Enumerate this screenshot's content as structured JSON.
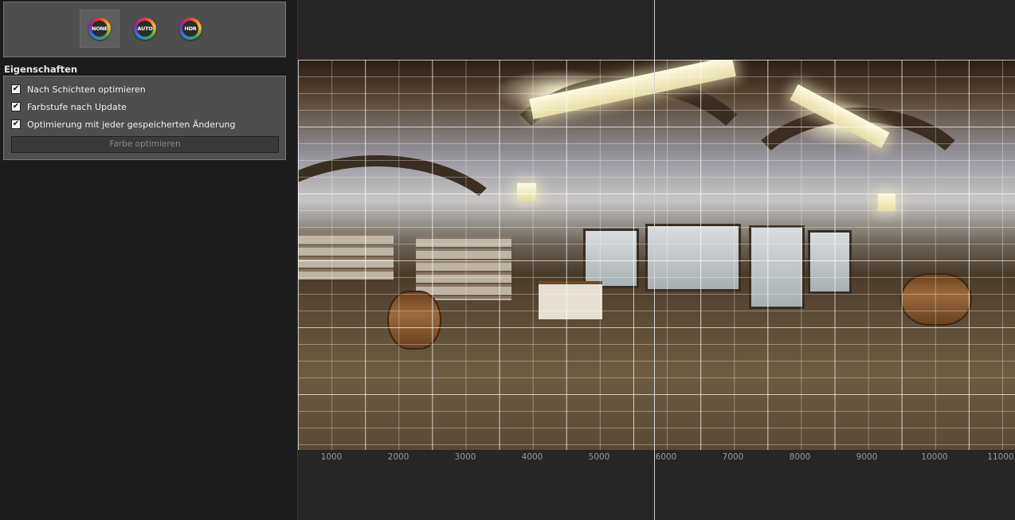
{
  "modes": [
    {
      "label": "NONE",
      "active": true
    },
    {
      "label": "AUTO",
      "active": false
    },
    {
      "label": "HDR",
      "active": false
    }
  ],
  "properties": {
    "title": "Eigenschaften",
    "options": [
      {
        "label": "Nach Schichten optimieren",
        "checked": true
      },
      {
        "label": "Farbstufe nach Update",
        "checked": true
      },
      {
        "label": "Optimierung mit jeder gespeicherten Änderung",
        "checked": true
      }
    ],
    "action_label": "Farbe optimieren"
  },
  "ruler": {
    "ticks": [
      "1000",
      "2000",
      "3000",
      "4000",
      "5000",
      "6000",
      "7000",
      "8000",
      "9000",
      "10000",
      "11000"
    ]
  },
  "colors": {
    "panel_bg": "#1c1c1c",
    "box_bg": "#4e4e4e",
    "viewport_bg": "#262626"
  }
}
